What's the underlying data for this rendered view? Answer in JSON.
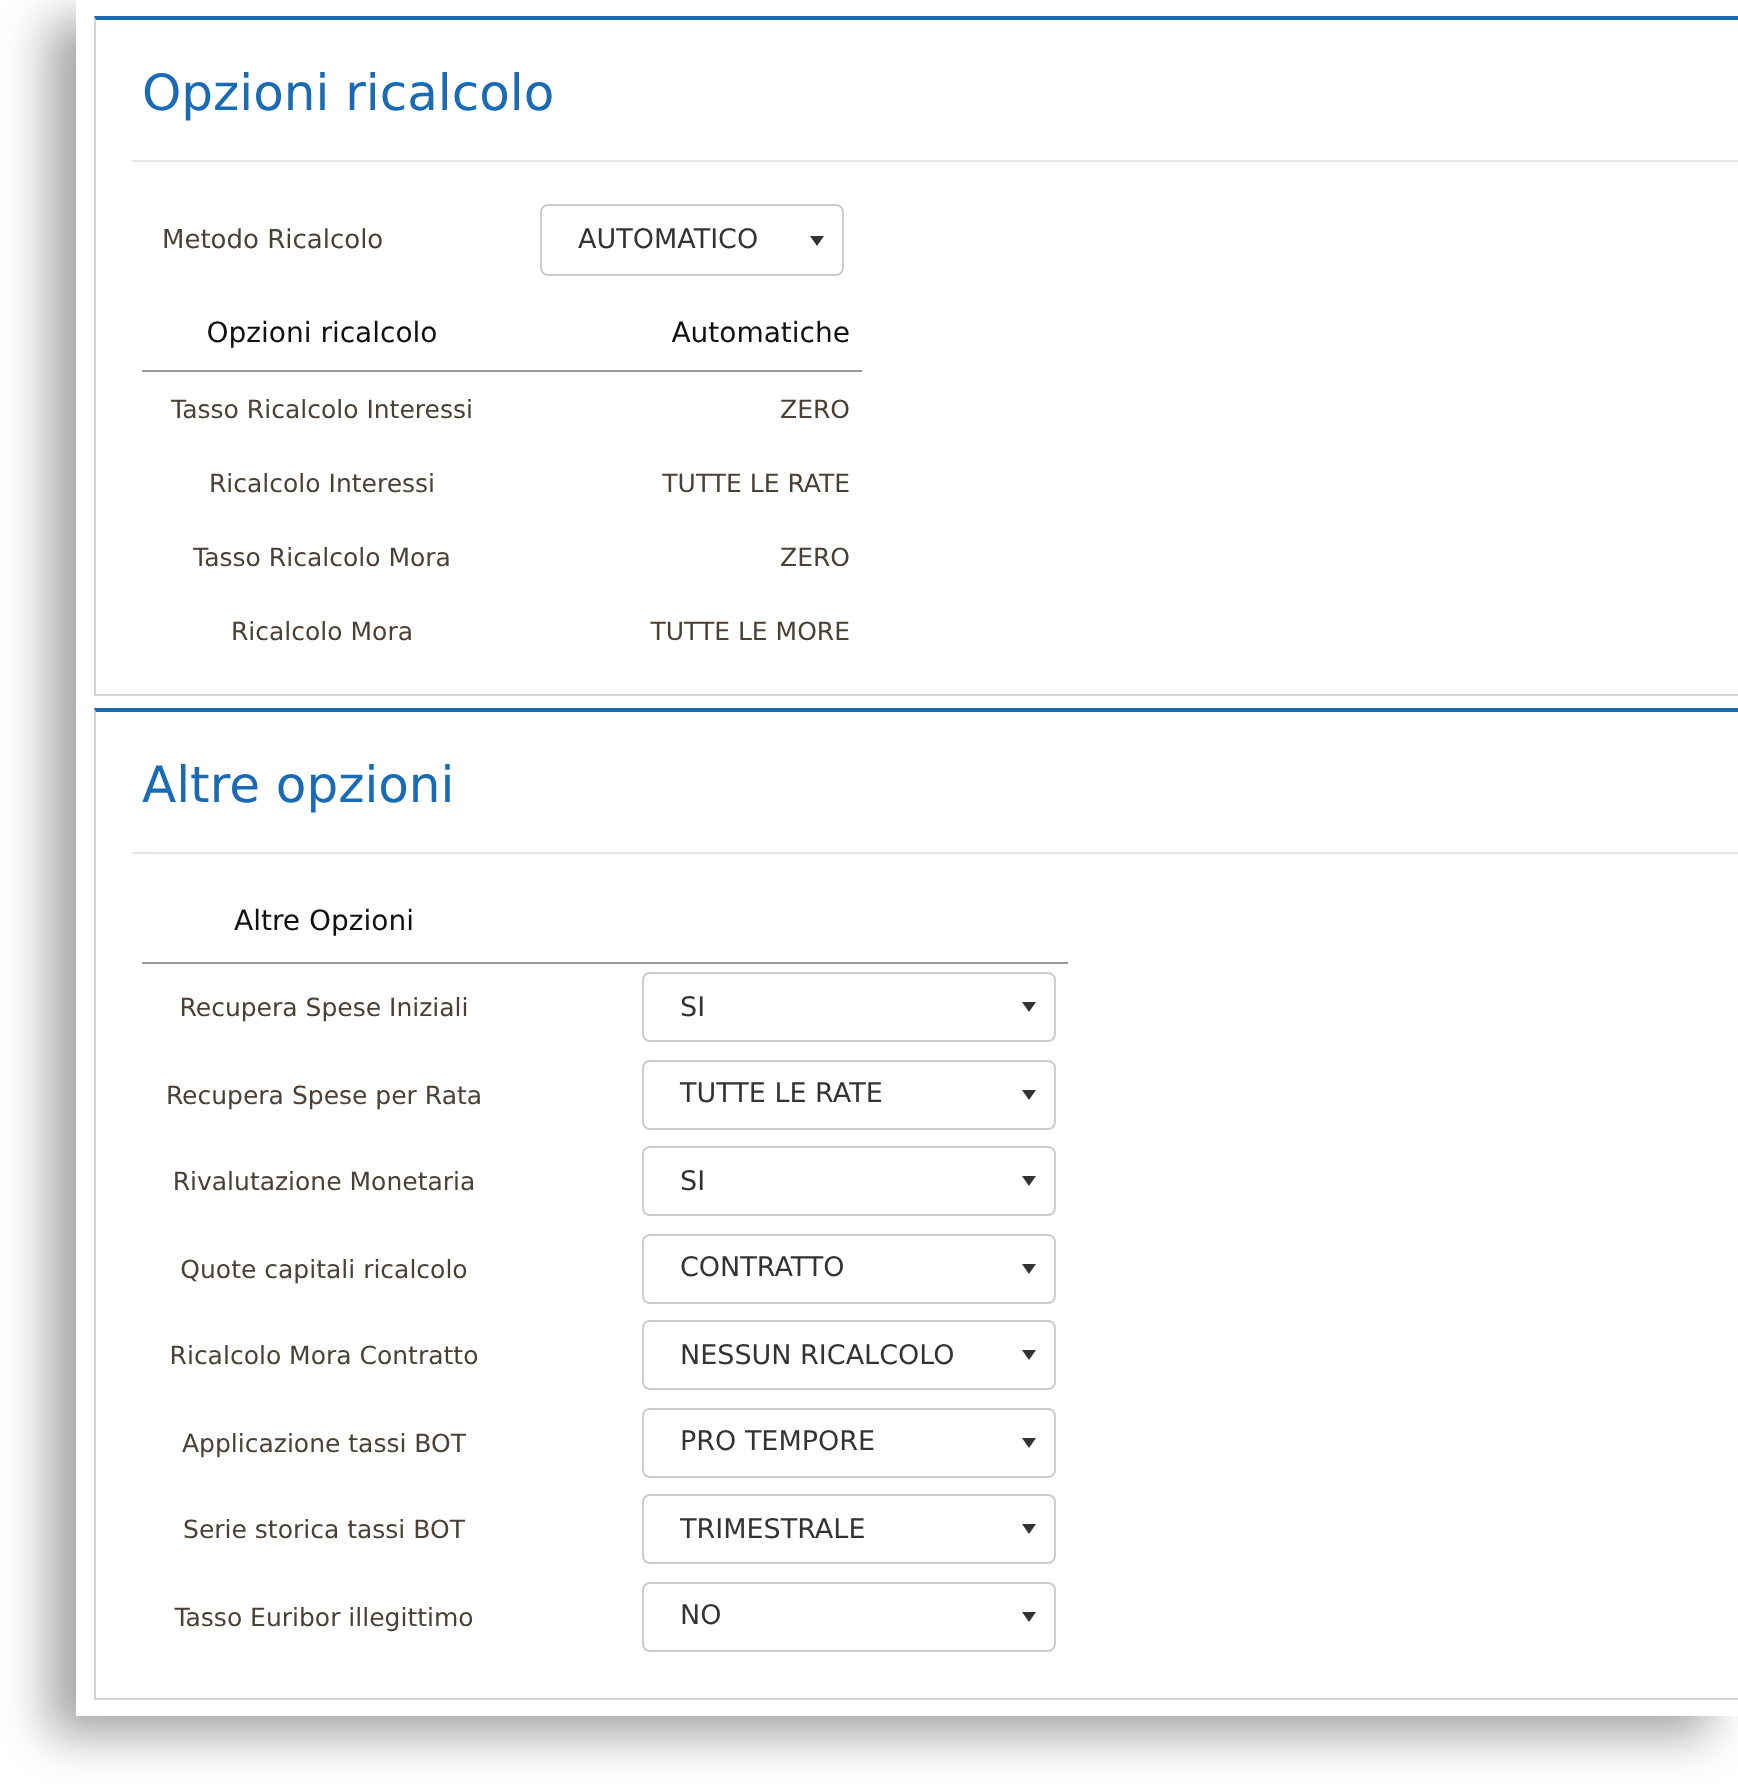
{
  "recalc_panel": {
    "title": "Opzioni ricalcolo",
    "method": {
      "label": "Metodo Ricalcolo",
      "value": "AUTOMATICO"
    },
    "table": {
      "columns": [
        "Opzioni ricalcolo",
        "Automatiche"
      ],
      "rows": [
        {
          "label": "Tasso Ricalcolo Interessi",
          "value": "ZERO"
        },
        {
          "label": "Ricalcolo Interessi",
          "value": "TUTTE LE RATE"
        },
        {
          "label": "Tasso Ricalcolo Mora",
          "value": "ZERO"
        },
        {
          "label": "Ricalcolo Mora",
          "value": "TUTTE LE MORE"
        }
      ]
    }
  },
  "other_panel": {
    "title": "Altre opzioni",
    "header": "Altre Opzioni",
    "rows": [
      {
        "label": "Recupera Spese Iniziali",
        "value": "SI"
      },
      {
        "label": "Recupera Spese per Rata",
        "value": "TUTTE LE RATE"
      },
      {
        "label": "Rivalutazione Monetaria",
        "value": "SI"
      },
      {
        "label": "Quote capitali ricalcolo",
        "value": "CONTRATTO"
      },
      {
        "label": "Ricalcolo Mora Contratto",
        "value": "NESSUN RICALCOLO"
      },
      {
        "label": "Applicazione tassi BOT",
        "value": "PRO TEMPORE"
      },
      {
        "label": "Serie storica tassi BOT",
        "value": "TRIMESTRALE"
      },
      {
        "label": "Tasso Euribor illegittimo",
        "value": "NO"
      }
    ]
  }
}
